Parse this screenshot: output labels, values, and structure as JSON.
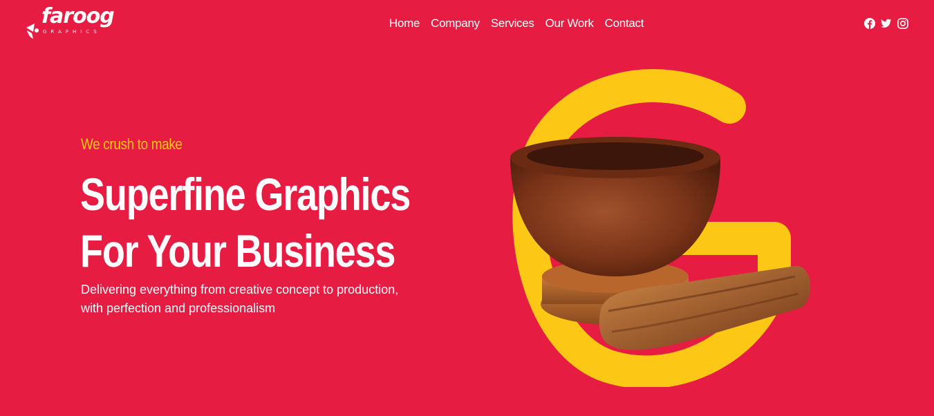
{
  "brand": {
    "logo_text": "faroog",
    "logo_sub": "GRAPHICS"
  },
  "nav": [
    "Home",
    "Company",
    "Services",
    "Our Work",
    "Contact"
  ],
  "social": [
    "facebook-icon",
    "twitter-icon",
    "instagram-icon"
  ],
  "hero": {
    "kicker": "We crush to make",
    "headline_line1": "Superfine Graphics",
    "headline_line2": "For Your Business",
    "subtext_line1": "Delivering everything from creative concept to production,",
    "subtext_line2": "with perfection and professionalism"
  },
  "colors": {
    "background": "#e61c42",
    "accent": "#fdc715",
    "text": "#ffffff",
    "wood": "#8b3a1a"
  }
}
